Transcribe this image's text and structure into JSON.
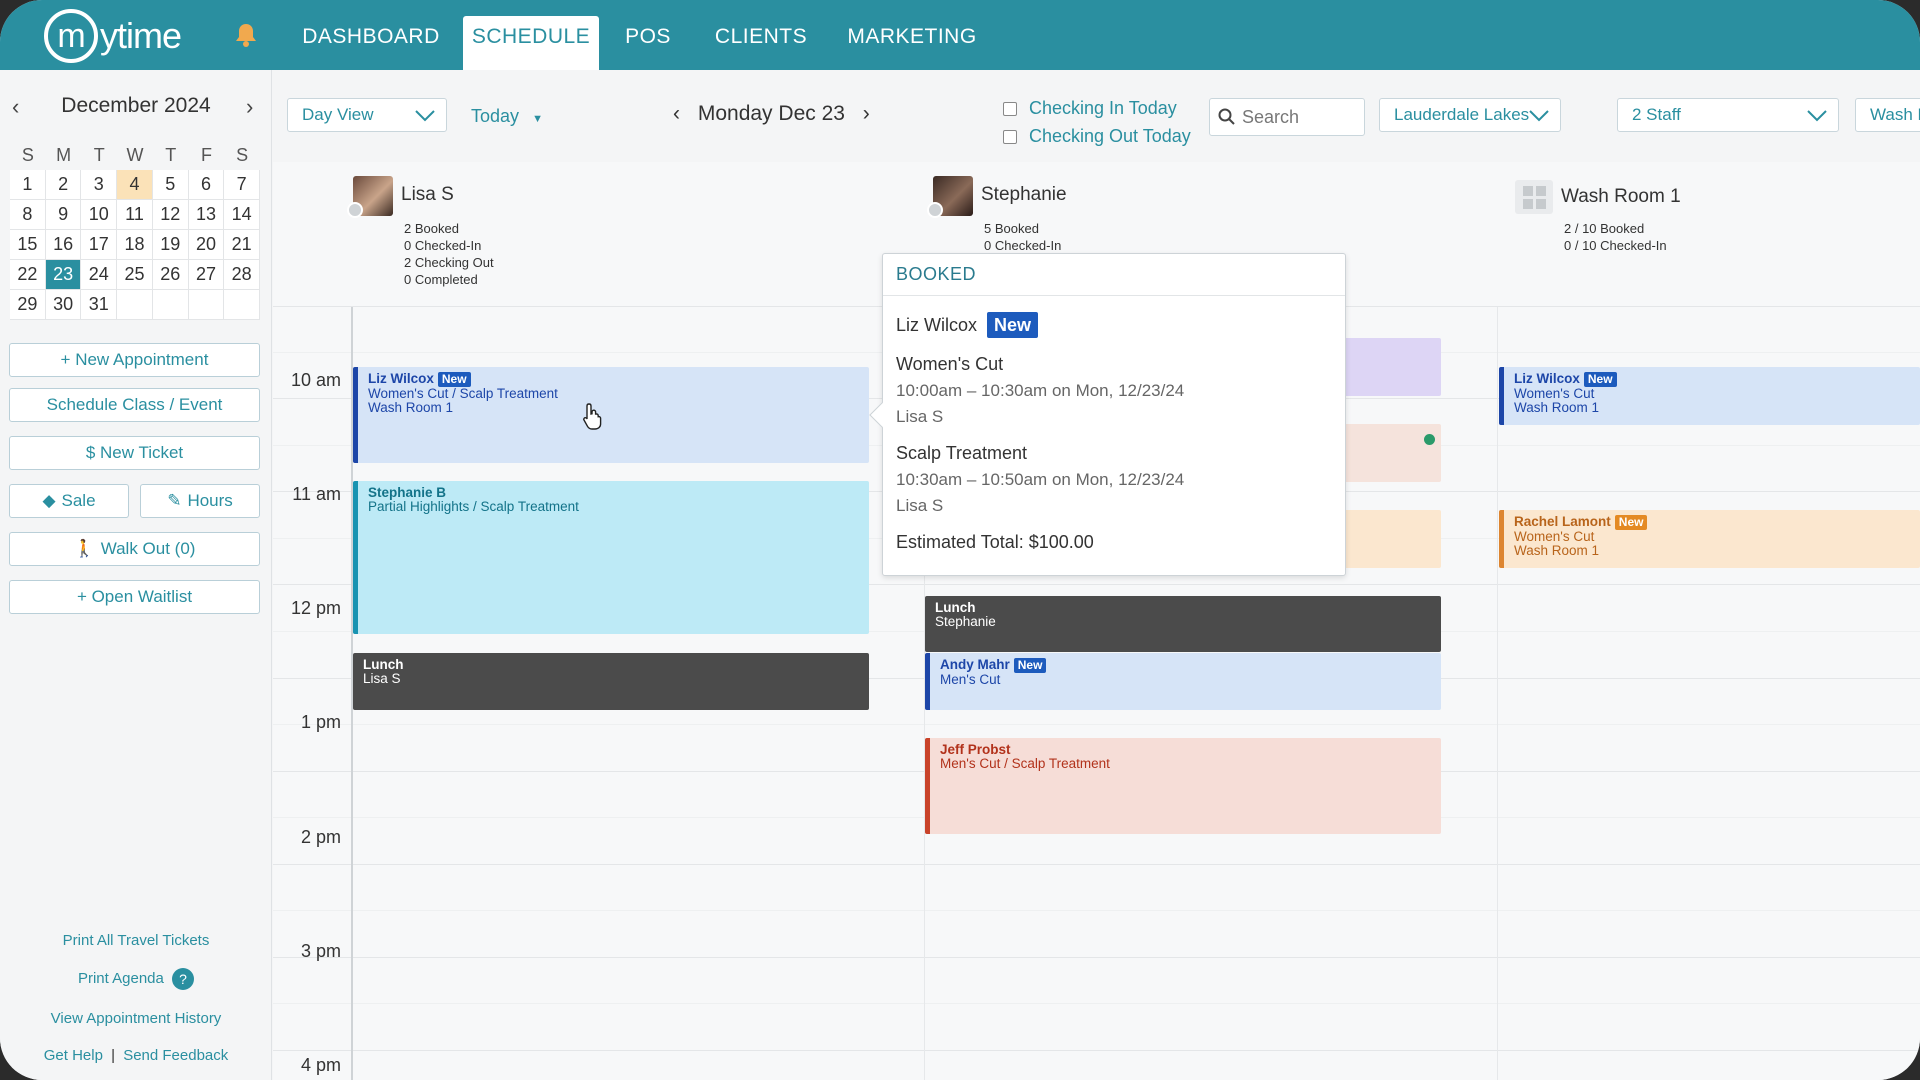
{
  "nav": {
    "logo_text": "ytime",
    "logo_letter": "m",
    "tabs": [
      {
        "label": "DASHBOARD",
        "active": false
      },
      {
        "label": "SCHEDULE",
        "active": true
      },
      {
        "label": "POS",
        "active": false
      },
      {
        "label": "CLIENTS",
        "active": false
      },
      {
        "label": "MARKETING",
        "active": false
      }
    ]
  },
  "calendar": {
    "month_label": "December 2024",
    "weekday_headers": [
      "S",
      "M",
      "T",
      "W",
      "T",
      "F",
      "S"
    ],
    "weeks": [
      [
        "1",
        "2",
        "3",
        "4",
        "5",
        "6",
        "7"
      ],
      [
        "8",
        "9",
        "10",
        "11",
        "12",
        "13",
        "14"
      ],
      [
        "15",
        "16",
        "17",
        "18",
        "19",
        "20",
        "21"
      ],
      [
        "22",
        "23",
        "24",
        "25",
        "26",
        "27",
        "28"
      ],
      [
        "29",
        "30",
        "31",
        "",
        "",
        "",
        ""
      ]
    ],
    "today": "4",
    "selected": "23"
  },
  "sidebar": {
    "new_appointment": "+ New Appointment",
    "schedule_class": "Schedule Class / Event",
    "new_ticket": "$  New Ticket",
    "sale": "Sale",
    "hours": "Hours",
    "walk_out": "Walk Out (0)",
    "open_waitlist": "+ Open Waitlist",
    "print_travel": "Print All Travel Tickets",
    "print_agenda": "Print Agenda",
    "help_glyph": "?",
    "view_history": "View Appointment History",
    "get_help": "Get Help",
    "send_feedback": "Send Feedback",
    "link_separator": "|"
  },
  "toolbar": {
    "view_select": "Day View",
    "today_label": "Today",
    "date_day": "Monday",
    "date_rest": "Dec 23",
    "checking_in": "Checking In Today",
    "checking_out": "Checking Out Today",
    "search_placeholder": "Search",
    "location": "Lauderdale Lakes",
    "staff_filter": "2 Staff",
    "room_filter": "Wash R"
  },
  "staff": [
    {
      "name": "Lisa S",
      "stats": [
        "2 Booked",
        "0 Checked-In",
        "2 Checking Out",
        "0 Completed"
      ]
    },
    {
      "name": "Stephanie",
      "stats": [
        "5 Booked",
        "0 Checked-In"
      ]
    },
    {
      "name": "Wash Room 1",
      "stats": [
        "2 / 10 Booked",
        "0 / 10 Checked-In"
      ]
    }
  ],
  "times": [
    "10 am",
    "11 am",
    "12 pm",
    "1 pm",
    "2 pm",
    "3 pm",
    "4 pm"
  ],
  "new_tag": "New",
  "appointments": {
    "lisa_liz": {
      "name": "Liz Wilcox",
      "line1": "Women's Cut / Scalp Treatment",
      "line2": "Wash Room 1"
    },
    "lisa_stephanie": {
      "name": "Stephanie B",
      "line1": "Partial Highlights / Scalp Treatment"
    },
    "lisa_lunch": {
      "name": "Lunch",
      "line1": "Lisa S"
    },
    "steph_lunch": {
      "name": "Lunch",
      "line1": "Stephanie"
    },
    "steph_andy": {
      "name": "Andy Mahr",
      "line1": "Men's Cut"
    },
    "steph_jeff": {
      "name": "Jeff Probst",
      "line1": "Men's Cut / Scalp Treatment"
    },
    "room_liz": {
      "name": "Liz Wilcox",
      "line1": "Women's Cut",
      "line2": "Wash Room 1"
    },
    "room_rachel": {
      "name": "Rachel Lamont",
      "line1": "Women's Cut",
      "line2": "Wash Room 1"
    }
  },
  "popover": {
    "status": "BOOKED",
    "client": "Liz Wilcox",
    "service1": "Women's Cut",
    "time1": "10:00am – 10:30am on Mon, 12/23/24",
    "staff1": "Lisa S",
    "service2": "Scalp Treatment",
    "time2": "10:30am – 10:50am on Mon, 12/23/24",
    "staff2": "Lisa S",
    "total": "Estimated Total: $100.00"
  },
  "colors": {
    "brand": "#2a8fa0",
    "new_badge": "#1d5bbd",
    "new_badge_alt": "#e48a24"
  }
}
